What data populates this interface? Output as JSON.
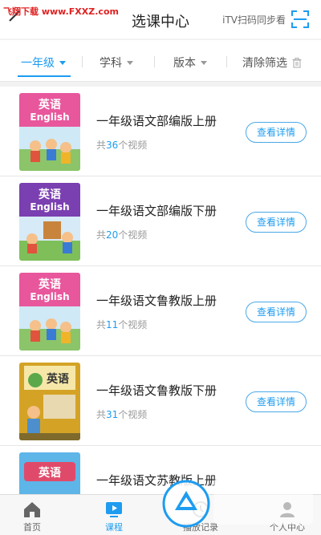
{
  "watermark": "飞翔下载 www.FXXZ.com",
  "header": {
    "title": "选课中心",
    "itv_label": "iTV扫码同步看"
  },
  "filters": [
    {
      "label": "一年级",
      "active": true
    },
    {
      "label": "学科",
      "active": false
    },
    {
      "label": "版本",
      "active": false
    }
  ],
  "clear_label": "清除筛选",
  "courses": [
    {
      "title": "一年级语文部编版上册",
      "count_prefix": "共",
      "count": "36",
      "count_suffix": "个视频",
      "button": "查看详情",
      "cover": {
        "word": "英语",
        "sub": "English",
        "color": "#e8569c"
      }
    },
    {
      "title": "一年级语文部编版下册",
      "count_prefix": "共",
      "count": "20",
      "count_suffix": "个视频",
      "button": "查看详情",
      "cover": {
        "word": "英语",
        "sub": "English",
        "color": "#7a3fb0"
      }
    },
    {
      "title": "一年级语文鲁教版上册",
      "count_prefix": "共",
      "count": "11",
      "count_suffix": "个视频",
      "button": "查看详情",
      "cover": {
        "word": "英语",
        "sub": "English",
        "color": "#e8569c"
      }
    },
    {
      "title": "一年级语文鲁教版下册",
      "count_prefix": "共",
      "count": "31",
      "count_suffix": "个视频",
      "button": "查看详情",
      "cover": {
        "word": "英语",
        "sub": "",
        "color": "#d4a326"
      }
    },
    {
      "title": "一年级语文苏教版上册",
      "count_prefix": "",
      "count": "",
      "count_suffix": "",
      "button": "",
      "cover": {
        "word": "英语",
        "sub": "",
        "color": "#e04a6a"
      }
    }
  ],
  "tabs": [
    {
      "label": "首页",
      "icon": "home-icon",
      "active": false
    },
    {
      "label": "课程",
      "icon": "course-icon",
      "active": true
    },
    {
      "label": "播放记录",
      "icon": "history-icon",
      "active": false
    },
    {
      "label": "个人中心",
      "icon": "profile-icon",
      "active": false
    }
  ],
  "site_logo": {
    "name": "飞翔下载",
    "url": "www.FXXZ.com"
  },
  "colors": {
    "accent": "#1d9cf0",
    "watermark": "#e02020"
  }
}
